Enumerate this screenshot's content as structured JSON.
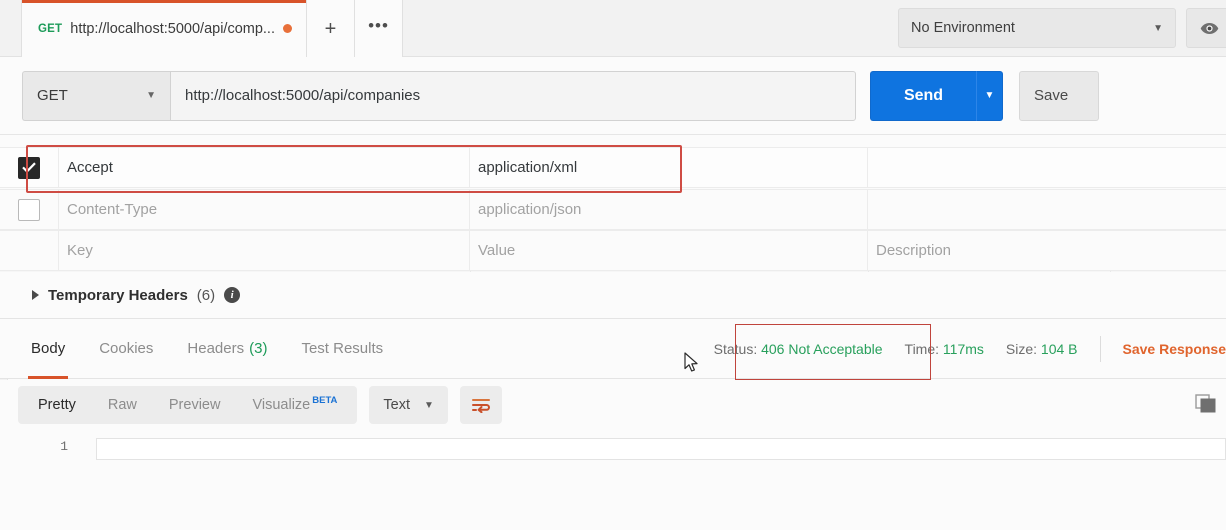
{
  "tabbar": {
    "request_tab": {
      "method": "GET",
      "name": "http://localhost:5000/api/comp...",
      "unsaved": "unsaved-dot"
    },
    "new_tab_label": "+",
    "more_label": "•••",
    "environment": {
      "value": "No Environment",
      "caret": "▼"
    },
    "eye_icon": "eye-icon"
  },
  "urlbar": {
    "method": "GET",
    "method_caret": "▼",
    "url": "http://localhost:5000/api/companies",
    "send_label": "Send",
    "send_caret": "▼",
    "save_label": "Save"
  },
  "headers": {
    "columns": {
      "key": "Key",
      "value": "Value",
      "description": "Description"
    },
    "rows": [
      {
        "checked": true,
        "key": "Accept",
        "value": "application/xml",
        "description": ""
      },
      {
        "checked": false,
        "key": "Content-Type",
        "value": "application/json",
        "description": ""
      }
    ],
    "highlight_color": "#cf4c44"
  },
  "temp_headers": {
    "label": "Temporary Headers",
    "count": "(6)",
    "info_icon": "info-icon",
    "caret": "triangle-right-icon"
  },
  "response": {
    "tabs": [
      {
        "label": "Body",
        "count": "",
        "active": true
      },
      {
        "label": "Cookies",
        "count": "",
        "active": false
      },
      {
        "label": "Headers",
        "count": "(3)",
        "active": false
      },
      {
        "label": "Test Results",
        "count": "",
        "active": false
      }
    ],
    "status": {
      "label": "Status:",
      "value": "406 Not Acceptable"
    },
    "time": {
      "label": "Time:",
      "value": "117ms"
    },
    "size": {
      "label": "Size:",
      "value": "104 B"
    },
    "save_response": "Save Response",
    "status_highlight_color": "#c0443c",
    "status_color": "#28a05c"
  },
  "viewbar": {
    "segments": [
      {
        "label": "Pretty",
        "active": true,
        "badge": ""
      },
      {
        "label": "Raw",
        "active": false,
        "badge": ""
      },
      {
        "label": "Preview",
        "active": false,
        "badge": ""
      },
      {
        "label": "Visualize",
        "active": false,
        "badge": "BETA"
      }
    ],
    "format": {
      "value": "Text",
      "caret": "▼"
    },
    "wrap_icon": "word-wrap-icon",
    "copy_icon": "copy-icon"
  },
  "body": {
    "line_numbers": [
      "1"
    ],
    "lines": [
      ""
    ]
  }
}
